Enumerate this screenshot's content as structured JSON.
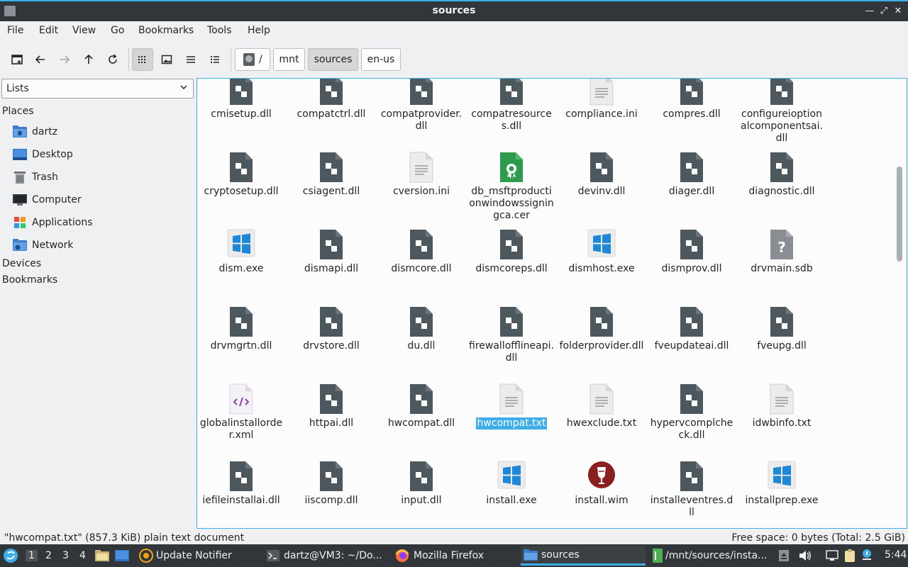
{
  "window": {
    "title": "sources"
  },
  "menu": [
    "File",
    "Edit",
    "View",
    "Go",
    "Bookmarks",
    "Tools",
    "Help"
  ],
  "breadcrumbs": [
    "/",
    "mnt",
    "sources",
    "en-us"
  ],
  "sidebar": {
    "combo": "Lists",
    "places_header": "Places",
    "places": [
      {
        "label": "dartz",
        "icon": "home-folder-icon"
      },
      {
        "label": "Desktop",
        "icon": "desktop-icon"
      },
      {
        "label": "Trash",
        "icon": "trash-icon"
      },
      {
        "label": "Computer",
        "icon": "computer-icon"
      },
      {
        "label": "Applications",
        "icon": "applications-icon"
      },
      {
        "label": "Network",
        "icon": "network-icon"
      }
    ],
    "devices_header": "Devices",
    "bookmarks_header": "Bookmarks"
  },
  "files": [
    {
      "name": "cmisetup.dll",
      "type": "dll"
    },
    {
      "name": "compatctrl.dll",
      "type": "dll"
    },
    {
      "name": "compatprovider.dll",
      "type": "dll"
    },
    {
      "name": "compatresources.dll",
      "type": "dll"
    },
    {
      "name": "compliance.ini",
      "type": "text"
    },
    {
      "name": "compres.dll",
      "type": "dll"
    },
    {
      "name": "configureioptionalcomponentsai.dll",
      "type": "dll"
    },
    {
      "name": "cryptosetup.dll",
      "type": "dll"
    },
    {
      "name": "csiagent.dll",
      "type": "dll"
    },
    {
      "name": "cversion.ini",
      "type": "text"
    },
    {
      "name": "db_msftproductionwindowssigningca.cer",
      "type": "cert"
    },
    {
      "name": "devinv.dll",
      "type": "dll"
    },
    {
      "name": "diager.dll",
      "type": "dll"
    },
    {
      "name": "diagnostic.dll",
      "type": "dll"
    },
    {
      "name": "dism.exe",
      "type": "exe"
    },
    {
      "name": "dismapi.dll",
      "type": "dll"
    },
    {
      "name": "dismcore.dll",
      "type": "dll"
    },
    {
      "name": "dismcoreps.dll",
      "type": "dll"
    },
    {
      "name": "dismhost.exe",
      "type": "exe"
    },
    {
      "name": "dismprov.dll",
      "type": "dll"
    },
    {
      "name": "drvmain.sdb",
      "type": "unknown"
    },
    {
      "name": "drvmgrtn.dll",
      "type": "dll"
    },
    {
      "name": "drvstore.dll",
      "type": "dll"
    },
    {
      "name": "du.dll",
      "type": "dll"
    },
    {
      "name": "firewallofflineapi.dll",
      "type": "dll"
    },
    {
      "name": "folderprovider.dll",
      "type": "dll"
    },
    {
      "name": "fveupdateai.dll",
      "type": "dll"
    },
    {
      "name": "fveupg.dll",
      "type": "dll"
    },
    {
      "name": "globalinstallorder.xml",
      "type": "xml"
    },
    {
      "name": "httpai.dll",
      "type": "dll"
    },
    {
      "name": "hwcompat.dll",
      "type": "dll"
    },
    {
      "name": "hwcompat.txt",
      "type": "text",
      "selected": true
    },
    {
      "name": "hwexclude.txt",
      "type": "text"
    },
    {
      "name": "hypervcomplcheck.dll",
      "type": "dll"
    },
    {
      "name": "idwbinfo.txt",
      "type": "text"
    },
    {
      "name": "iefileinstallai.dll",
      "type": "dll"
    },
    {
      "name": "iiscomp.dll",
      "type": "dll"
    },
    {
      "name": "input.dll",
      "type": "dll"
    },
    {
      "name": "install.exe",
      "type": "exe"
    },
    {
      "name": "install.wim",
      "type": "wim"
    },
    {
      "name": "installeventres.dll",
      "type": "dll"
    },
    {
      "name": "installprep.exe",
      "type": "exe"
    }
  ],
  "status": {
    "left": "\"hwcompat.txt\" (857.3 KiB) plain text document",
    "right": "Free space: 0 bytes (Total: 2.5 GiB)"
  },
  "taskbar": {
    "workspaces": [
      "1",
      "2",
      "3",
      "4"
    ],
    "tasks": [
      {
        "label": "Update Notifier",
        "icon": "update-notifier-icon"
      },
      {
        "label": "dartz@VM3: ~/Do...",
        "icon": "terminal-icon"
      },
      {
        "label": "Mozilla Firefox",
        "icon": "firefox-icon"
      },
      {
        "label": "sources",
        "icon": "folder-icon",
        "active": true
      },
      {
        "label": "/mnt/sources/insta...",
        "icon": "text-editor-icon"
      }
    ],
    "clock": "5:44"
  },
  "colors": {
    "accent": "#3daee9",
    "dark": "#31363b",
    "dll_icon": "#4d575e",
    "windows_blue": "#1e88d8"
  }
}
